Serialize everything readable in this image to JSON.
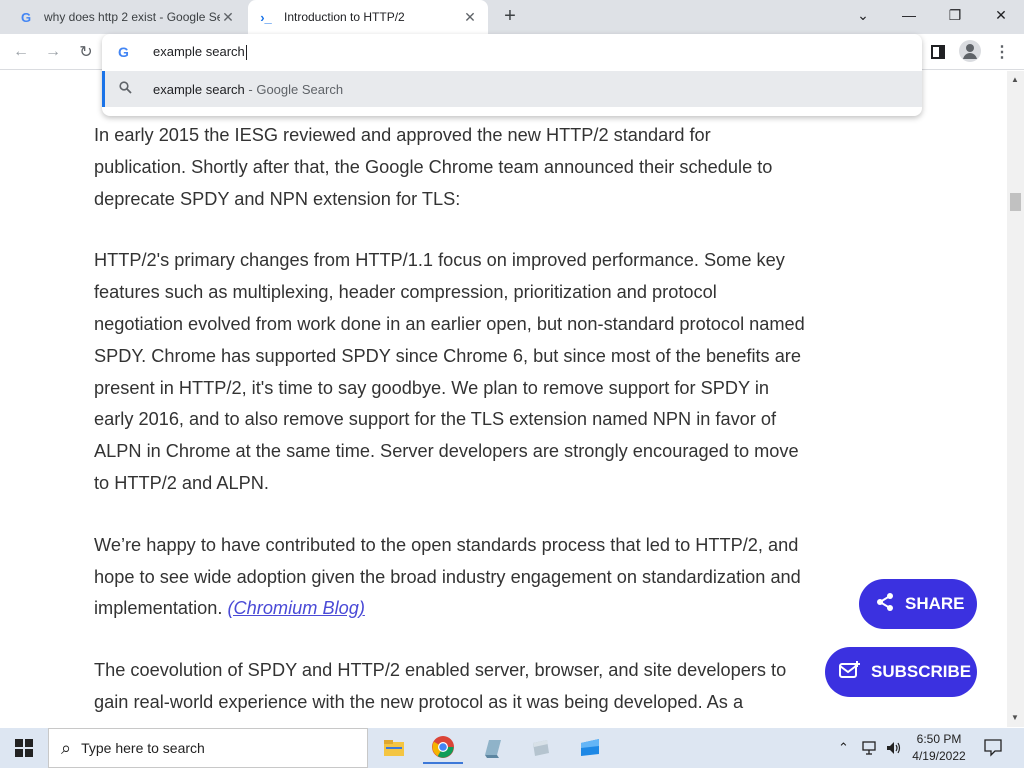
{
  "tabs": [
    {
      "title": "why does http 2 exist - Google Se",
      "favicon": "google-g-icon"
    },
    {
      "title": "Introduction to HTTP/2",
      "favicon": "web-dev-icon"
    }
  ],
  "omnibox": {
    "query": "example search",
    "suggestion": {
      "text": "example search",
      "suffix": " - Google Search"
    }
  },
  "article": {
    "paragraphs": [
      "In early 2015 the IESG reviewed and approved the new HTTP/2 standard for publication. Shortly after that, the Google Chrome team announced their schedule to deprecate SPDY and NPN extension for TLS:",
      "HTTP/2's primary changes from HTTP/1.1 focus on improved performance. Some key features such as multiplexing, header compression, prioritization and protocol negotiation evolved from work done in an earlier open, but non-standard protocol named SPDY. Chrome has supported SPDY since Chrome 6, but since most of the benefits are present in HTTP/2, it's time to say goodbye. We plan to remove support for SPDY in early 2016, and to also remove support for the TLS extension named NPN in favor of ALPN in Chrome at the same time. Server developers are strongly encouraged to move to HTTP/2 and ALPN.",
      "We’re happy to have contributed to the open standards process that led to HTTP/2, and hope to see wide adoption given the broad industry engagement on standardization and implementation.",
      "The coevolution of SPDY and HTTP/2 enabled server, browser, and site developers to gain real-world experience with the new protocol as it was being developed. As a"
    ],
    "link_text": "(Chromium Blog)"
  },
  "fabs": {
    "share": "SHARE",
    "subscribe": "SUBSCRIBE"
  },
  "taskbar": {
    "search_placeholder": "Type here to search",
    "time": "6:50 PM",
    "date": "4/19/2022"
  },
  "colors": {
    "accent": "#3b31e0",
    "link": "#4a4ad6",
    "omni_highlight": "#1a73e8"
  }
}
